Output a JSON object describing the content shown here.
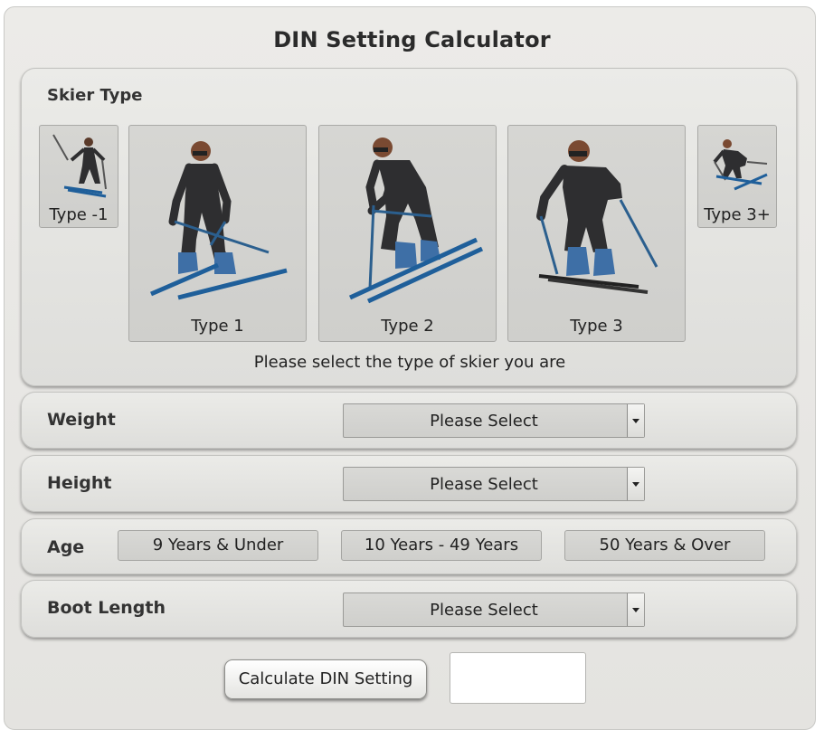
{
  "title": "DIN Setting Calculator",
  "skier_type": {
    "label": "Skier Type",
    "cards": [
      {
        "label": "Type -1",
        "icon": "skier-type-minus1-icon"
      },
      {
        "label": "Type 1",
        "icon": "skier-type-1-icon"
      },
      {
        "label": "Type 2",
        "icon": "skier-type-2-icon"
      },
      {
        "label": "Type 3",
        "icon": "skier-type-3-icon"
      },
      {
        "label": "Type 3+",
        "icon": "skier-type-3plus-icon"
      }
    ],
    "prompt": "Please select the type of skier you are"
  },
  "weight": {
    "label": "Weight",
    "selected": "Please Select"
  },
  "height": {
    "label": "Height",
    "selected": "Please Select"
  },
  "age": {
    "label": "Age",
    "options": [
      "9 Years & Under",
      "10 Years - 49 Years",
      "50 Years & Over"
    ]
  },
  "boot_length": {
    "label": "Boot Length",
    "selected": "Please Select"
  },
  "calculate_button": "Calculate DIN Setting",
  "result": "",
  "colors": {
    "ski": "#1f5f9a",
    "boot": "#3e6fa6",
    "suit": "#2e2e30"
  }
}
